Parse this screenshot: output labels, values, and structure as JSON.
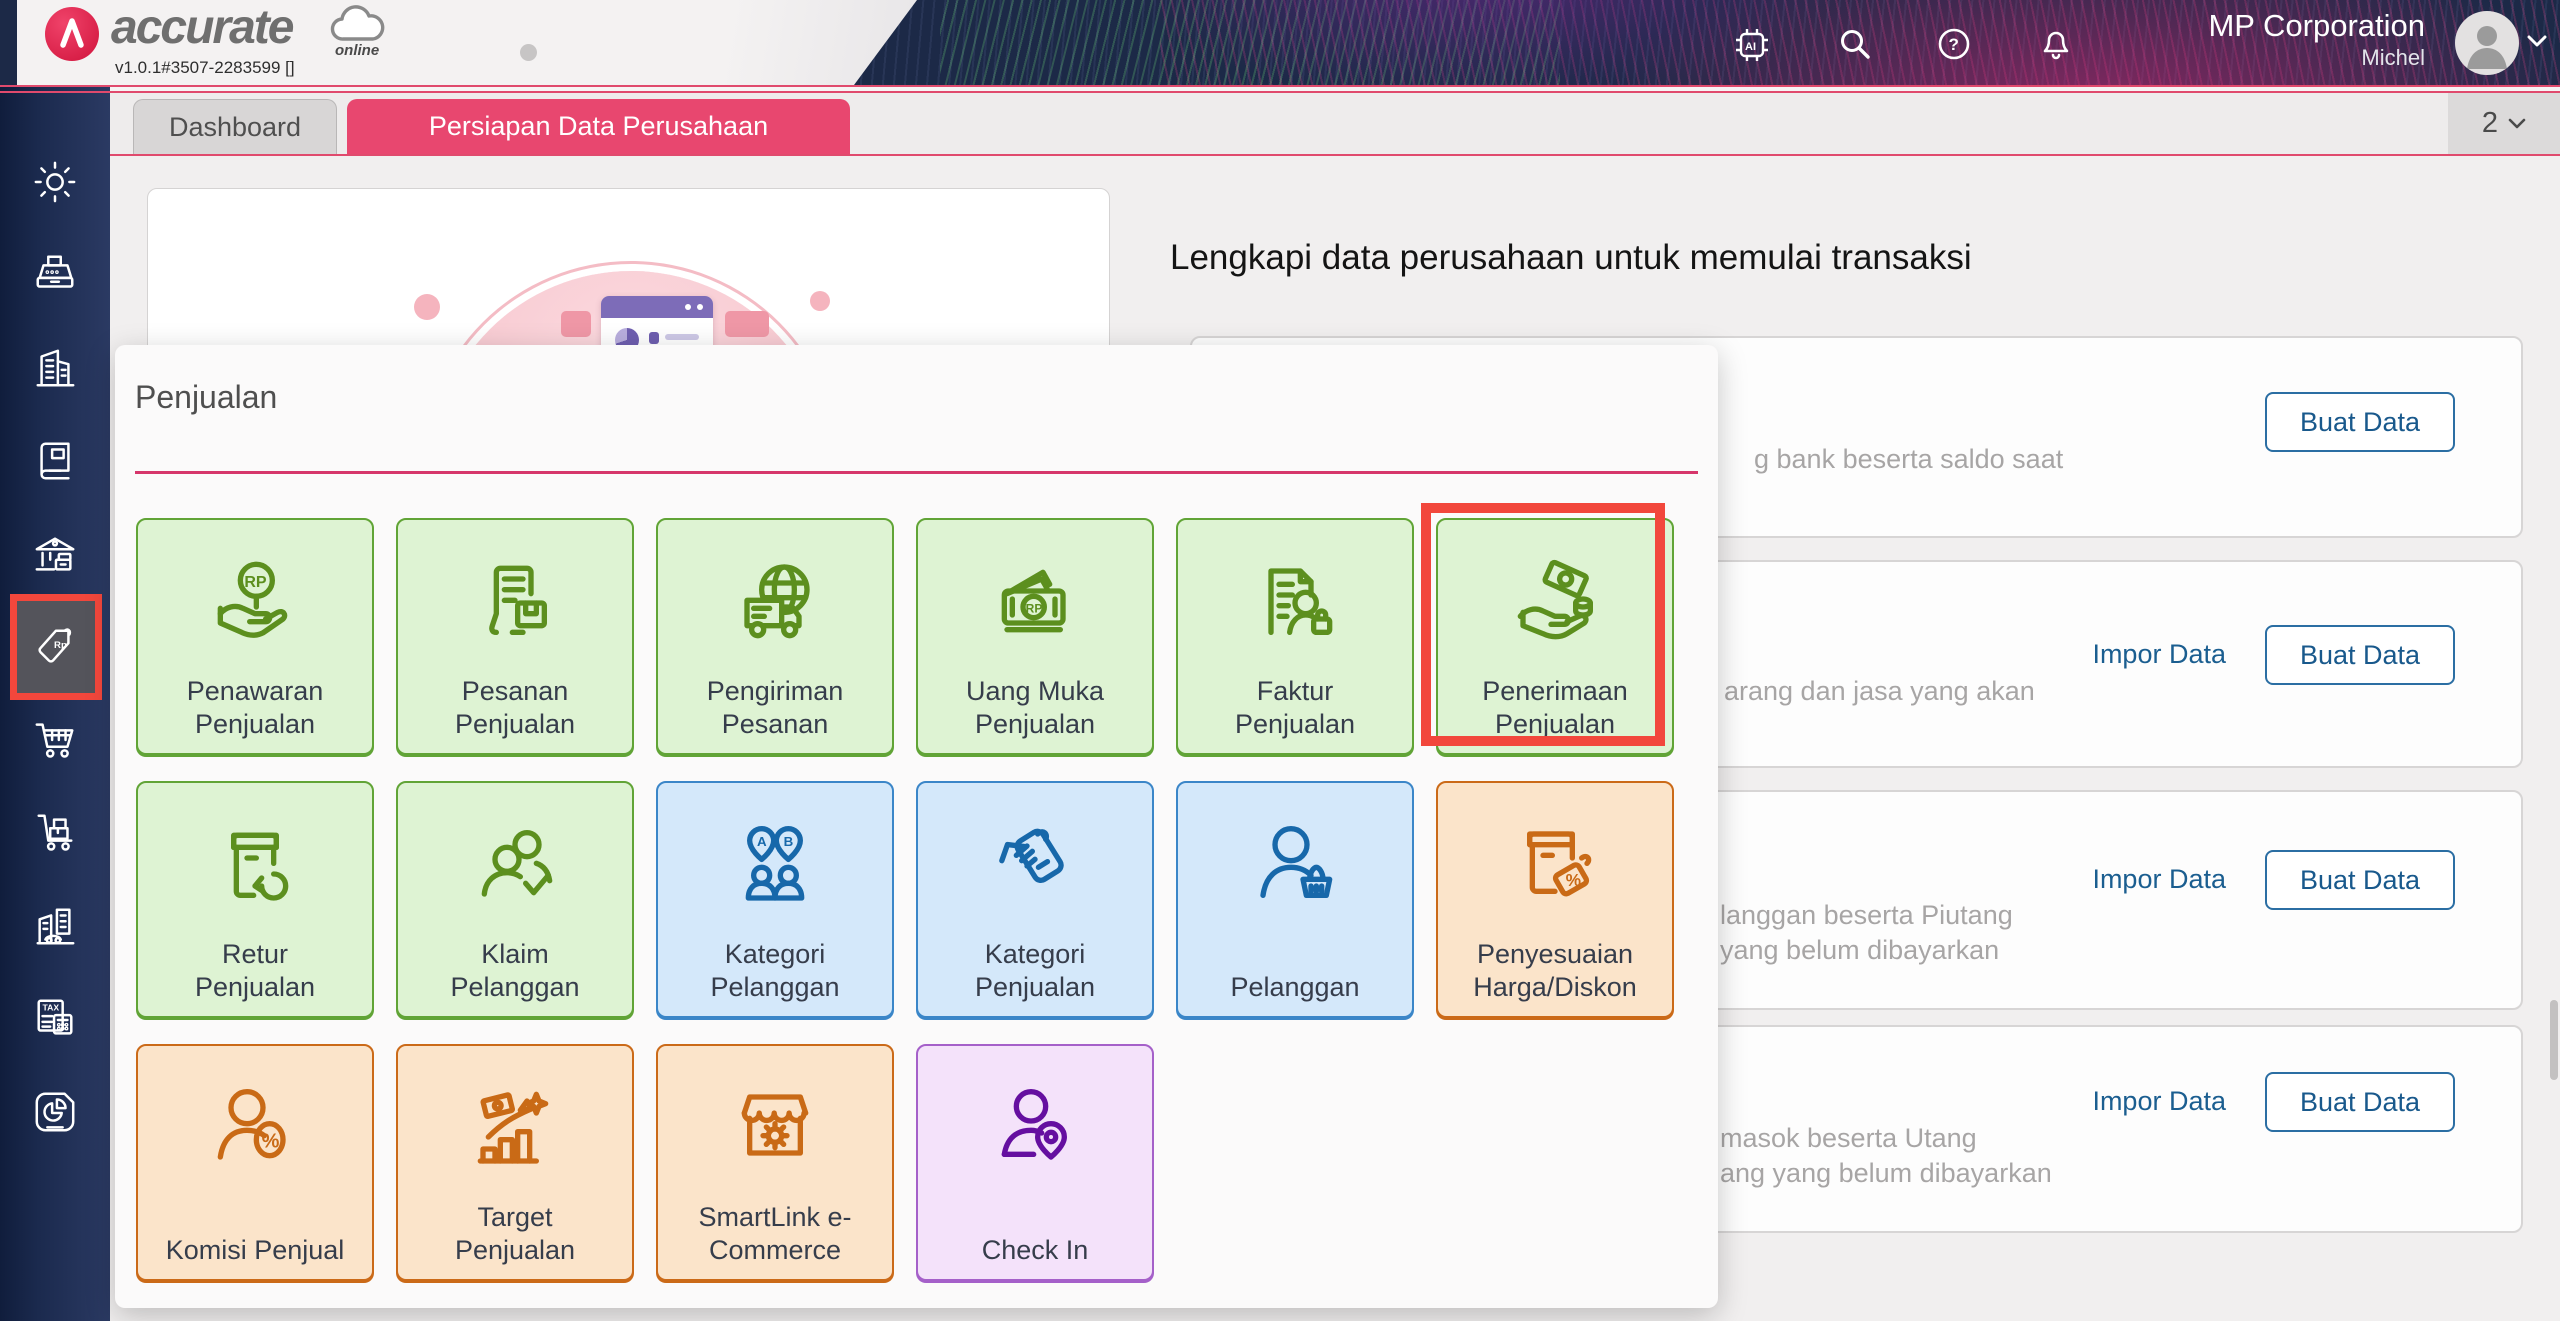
{
  "header": {
    "brand_name": "accurate",
    "brand_sub": "online",
    "version": "v1.0.1#3507-2283599 []",
    "company": "MP Corporation",
    "user": "Michel"
  },
  "tabbar": {
    "tabs": [
      {
        "label": "Dashboard"
      },
      {
        "label": "Persiapan Data Perusahaan"
      }
    ],
    "count": "2"
  },
  "modal": {
    "title": "Penjualan",
    "tiles": [
      {
        "label": "Penawaran\nPenjualan",
        "color": "green"
      },
      {
        "label": "Pesanan\nPenjualan",
        "color": "green"
      },
      {
        "label": "Pengiriman\nPesanan",
        "color": "green"
      },
      {
        "label": "Uang Muka\nPenjualan",
        "color": "green"
      },
      {
        "label": "Faktur\nPenjualan",
        "color": "green"
      },
      {
        "label": "Penerimaan\nPenjualan",
        "color": "green",
        "highlighted": true
      },
      {
        "label": "Retur\nPenjualan",
        "color": "green"
      },
      {
        "label": "Klaim\nPelanggan",
        "color": "green"
      },
      {
        "label": "Kategori\nPelanggan",
        "color": "blue"
      },
      {
        "label": "Kategori\nPenjualan",
        "color": "blue"
      },
      {
        "label": "Pelanggan",
        "color": "blue"
      },
      {
        "label": "Penyesuaian\nHarga/Diskon",
        "color": "orange"
      },
      {
        "label": "Komisi Penjual",
        "color": "orange"
      },
      {
        "label": "Target\nPenjualan",
        "color": "orange"
      },
      {
        "label": "SmartLink e-\nCommerce",
        "color": "orange"
      },
      {
        "label": "Check In",
        "color": "purple"
      }
    ]
  },
  "panel": {
    "heading": "Lengkapi data perusahaan untuk memulai transaksi",
    "cards": [
      {
        "text": "g bank beserta saldo saat",
        "buat": "Buat Data"
      },
      {
        "text": "arang dan jasa yang akan",
        "impor": "Impor Data",
        "buat": "Buat Data"
      },
      {
        "text": "langgan beserta Piutang\nyang belum dibayarkan",
        "impor": "Impor Data",
        "buat": "Buat Data"
      },
      {
        "text": "masok beserta Utang\nang yang belum dibayarkan",
        "impor": "Impor Data",
        "buat": "Buat Data"
      }
    ]
  },
  "colors": {
    "accent_pink": "#e8476f",
    "annotation_red": "#f2473c",
    "sidebar_navy": "#1b2a4e",
    "tile_green_bg": "#def3d3",
    "tile_green_border": "#61a436",
    "tile_blue_bg": "#d4e8fa",
    "tile_blue_border": "#3b86c8",
    "tile_orange_bg": "#fbe4ca",
    "tile_orange_border": "#cb6a18",
    "tile_purple_bg": "#f4e2fa",
    "tile_purple_border": "#a560c9",
    "button_blue": "#2b6ea3",
    "divider_pink": "#d6366b"
  }
}
